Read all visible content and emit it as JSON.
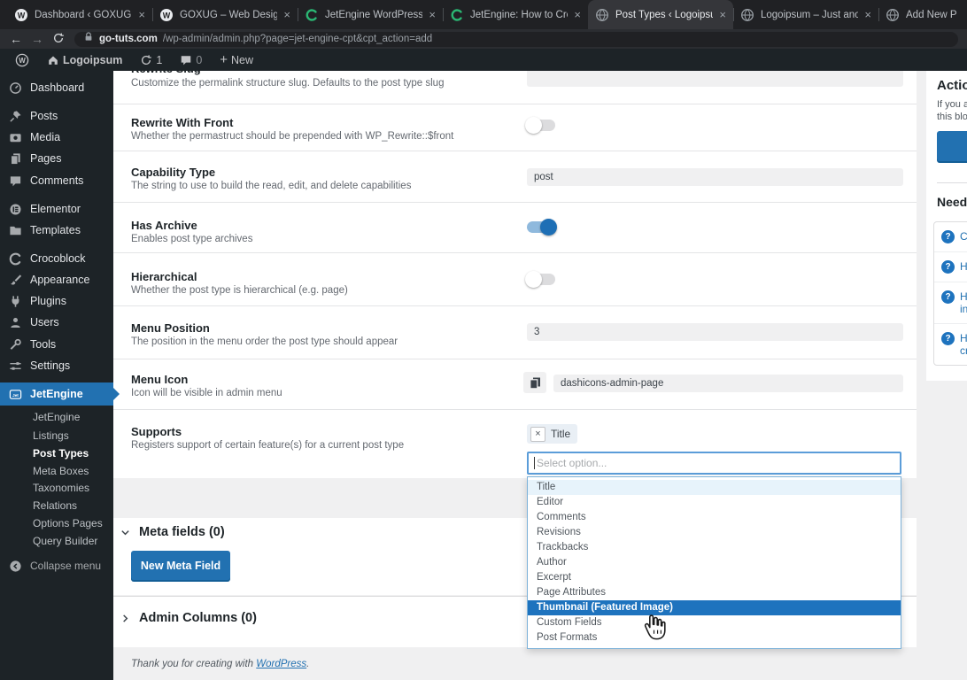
{
  "browser": {
    "tabs": [
      {
        "title": "Dashboard ‹ GOXUG — WordP",
        "icon": "wordpress"
      },
      {
        "title": "GOXUG – Web Design Portfolio",
        "icon": "wordpress"
      },
      {
        "title": "JetEngine WordPress Custom",
        "icon": "crocoblock"
      },
      {
        "title": "JetEngine: How to Create Cust",
        "icon": "crocoblock"
      },
      {
        "title": "Post Types ‹ Logoipsum — Wo",
        "icon": "globe",
        "active": true
      },
      {
        "title": "Logoipsum – Just another Wor",
        "icon": "globe"
      },
      {
        "title": "Add New P",
        "icon": "globe"
      }
    ],
    "url_domain": "go-tuts.com",
    "url_path": "/wp-admin/admin.php?page=jet-engine-cpt&cpt_action=add"
  },
  "glyphs": {
    "close": "×",
    "back": "←",
    "forward": "→",
    "plus": "+",
    "question": "?"
  },
  "admin_bar": {
    "site_name": "Logoipsum",
    "update_count": "1",
    "comment_count": "0",
    "new_label": "New"
  },
  "sidebar": {
    "items": [
      {
        "label": "Dashboard"
      },
      {
        "label": "Posts"
      },
      {
        "label": "Media"
      },
      {
        "label": "Pages"
      },
      {
        "label": "Comments"
      },
      {
        "label": "Elementor"
      },
      {
        "label": "Templates"
      },
      {
        "label": "Crocoblock"
      },
      {
        "label": "Appearance"
      },
      {
        "label": "Plugins"
      },
      {
        "label": "Users"
      },
      {
        "label": "Tools"
      },
      {
        "label": "Settings"
      },
      {
        "label": "JetEngine"
      }
    ],
    "submenu": [
      "JetEngine",
      "Listings",
      "Post Types",
      "Meta Boxes",
      "Taxonomies",
      "Relations",
      "Options Pages",
      "Query Builder"
    ],
    "collapse_label": "Collapse menu"
  },
  "form": {
    "rows": [
      {
        "label": "Rewrite Slug",
        "desc": "Customize the permalink structure slug. Defaults to the post type slug",
        "value": ""
      },
      {
        "label": "Rewrite With Front",
        "desc": "Whether the permastruct should be prepended with WP_Rewrite::$front",
        "on": false
      },
      {
        "label": "Capability Type",
        "desc": "The string to use to build the read, edit, and delete capabilities",
        "value": "post"
      },
      {
        "label": "Has Archive",
        "desc": "Enables post type archives",
        "on": true
      },
      {
        "label": "Hierarchical",
        "desc": "Whether the post type is hierarchical (e.g. page)",
        "on": false
      },
      {
        "label": "Menu Position",
        "desc": "The position in the menu order the post type should appear",
        "value": "3"
      },
      {
        "label": "Menu Icon",
        "desc": "Icon will be visible in admin menu",
        "value": "dashicons-admin-page"
      },
      {
        "label": "Supports",
        "desc": "Registers support of certain feature(s) for a current post type",
        "tag": "Title"
      }
    ]
  },
  "supports_dropdown": {
    "placeholder": "Select option...",
    "options": [
      "Title",
      "Editor",
      "Comments",
      "Revisions",
      "Trackbacks",
      "Author",
      "Excerpt",
      "Page Attributes",
      "Thumbnail (Featured Image)",
      "Custom Fields",
      "Post Formats"
    ]
  },
  "sections": {
    "meta_fields": "Meta fields (0)",
    "new_meta_field_button": "New Meta Field",
    "admin_columns": "Admin Columns (0)"
  },
  "footer": {
    "text": "Thank you for creating with ",
    "link": "WordPress",
    "suffix": "."
  },
  "right_panel": {
    "heading": "Action",
    "body_line1": "If you are",
    "body_line2": "this bloc",
    "help_heading": "Need H",
    "links": [
      [
        "C"
      ],
      [
        "H"
      ],
      [
        "H",
        "in"
      ],
      [
        "H",
        "cr"
      ]
    ]
  },
  "colors": {
    "accent": "#2271b1",
    "selected_option": "#1e73be",
    "admin_dark": "#1d2327"
  }
}
